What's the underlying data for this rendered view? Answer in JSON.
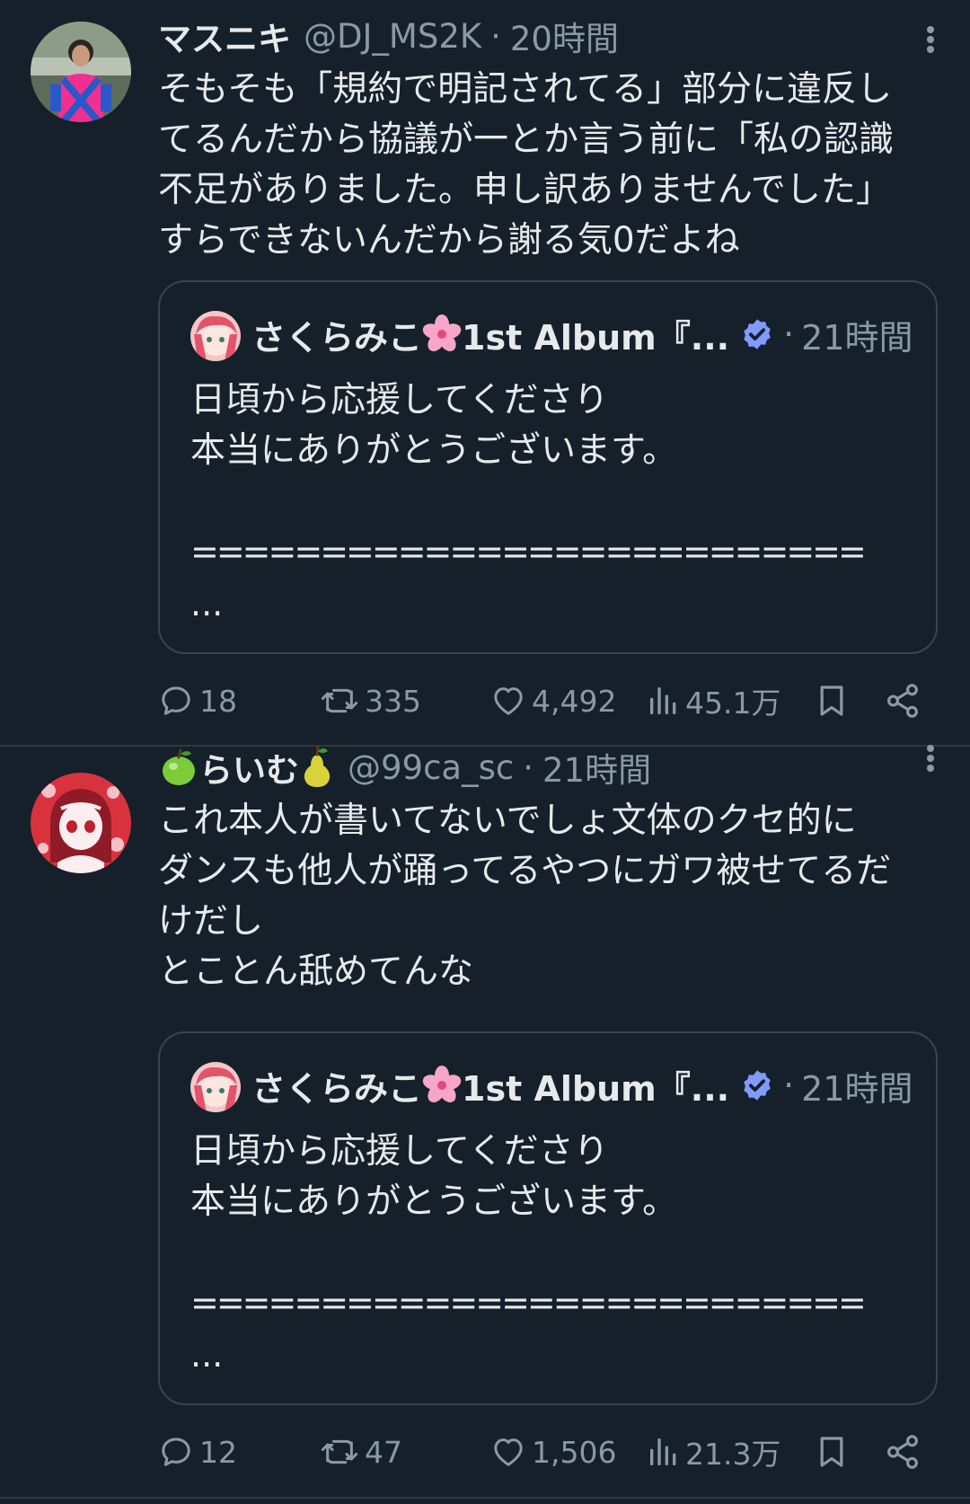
{
  "colors": {
    "background": "#15202b",
    "text_primary": "#e7e9ea",
    "text_secondary": "#8b98a5",
    "border": "#38444d",
    "verified_badge": "#829aff"
  },
  "tweets": [
    {
      "author_name": "マスニキ",
      "handle": "@DJ_MS2K",
      "time_sep": "·",
      "time": "20時間",
      "avatar_icon": "jockey-avatar",
      "body": "そもそも「規約で明記されてる」部分に違反し\nてるんだから協議が一とか言う前に「私の認識\n不足がありました。申し訳ありませんでした」\nすらできないんだから謝る気0だよね",
      "quote": {
        "author_name": "さくらみこ",
        "name_emoji": "cherry-blossom-icon",
        "author_name_suffix": "1st Album『...",
        "verified_icon": "verified-badge-icon",
        "time_sep": "·",
        "time": "21時間",
        "body": "日頃から応援してくださり\n本当にありがとうございます。",
        "separator": "==========================",
        "ellipsis": "..."
      },
      "stats": {
        "replies": "18",
        "retweets": "335",
        "likes": "4,492",
        "views": "45.1万"
      }
    },
    {
      "author_name": "らいむ",
      "name_prefix_emoji": "green-apple-icon",
      "name_suffix_emoji": "pear-icon",
      "handle": "@99ca_sc",
      "time_sep": "·",
      "time": "21時間",
      "avatar_icon": "illustrated-avatar",
      "body": "これ本人が書いてないでしょ文体のクセ的に\nダンスも他人が踊ってるやつにガワ被せてるだ\nけだし\nとことん舐めてんな",
      "quote": {
        "author_name": "さくらみこ",
        "name_emoji": "cherry-blossom-icon",
        "author_name_suffix": "1st Album『...",
        "verified_icon": "verified-badge-icon",
        "time_sep": "·",
        "time": "21時間",
        "body": "日頃から応援してくださり\n本当にありがとうございます。",
        "separator": "==========================",
        "ellipsis": "..."
      },
      "stats": {
        "replies": "12",
        "retweets": "47",
        "likes": "1,506",
        "views": "21.3万"
      }
    }
  ]
}
